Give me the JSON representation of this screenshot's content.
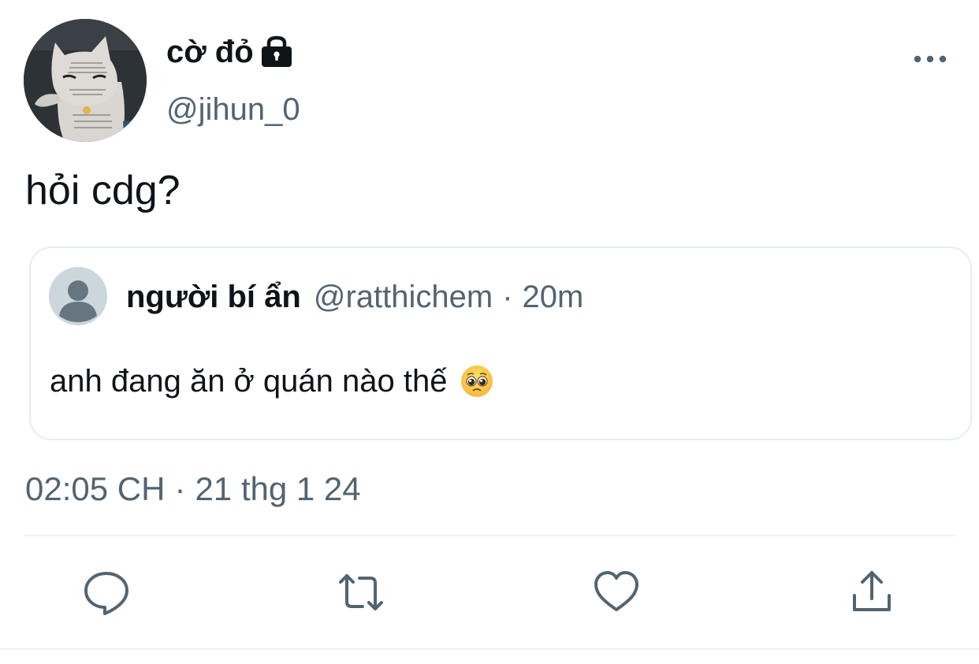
{
  "tweet": {
    "author": {
      "display_name": "cờ đỏ",
      "handle": "@jihun_0",
      "protected_icon": "lock-icon",
      "avatar": "cat-avatar"
    },
    "text": "hỏi cdg?",
    "timestamp": {
      "time": "02:05 CH",
      "separator": "·",
      "date": "21 thg 1 24"
    },
    "more_icon": "more-horizontal-icon"
  },
  "quoted_tweet": {
    "author": {
      "display_name": "người bí ẩn",
      "handle": "@ratthichem",
      "avatar": "default-user-avatar"
    },
    "separator": "·",
    "time_ago": "20m",
    "text": "anh đang ăn ở quán nào thế",
    "emoji_icon": "pleading-face-icon"
  },
  "actions": [
    {
      "name": "reply",
      "icon": "reply-icon"
    },
    {
      "name": "retweet",
      "icon": "retweet-icon"
    },
    {
      "name": "like",
      "icon": "heart-icon"
    },
    {
      "name": "share",
      "icon": "share-icon"
    }
  ],
  "colors": {
    "text_primary": "#0f1419",
    "text_secondary": "#536471",
    "border": "#e6ecf0",
    "icon": "#536471"
  }
}
